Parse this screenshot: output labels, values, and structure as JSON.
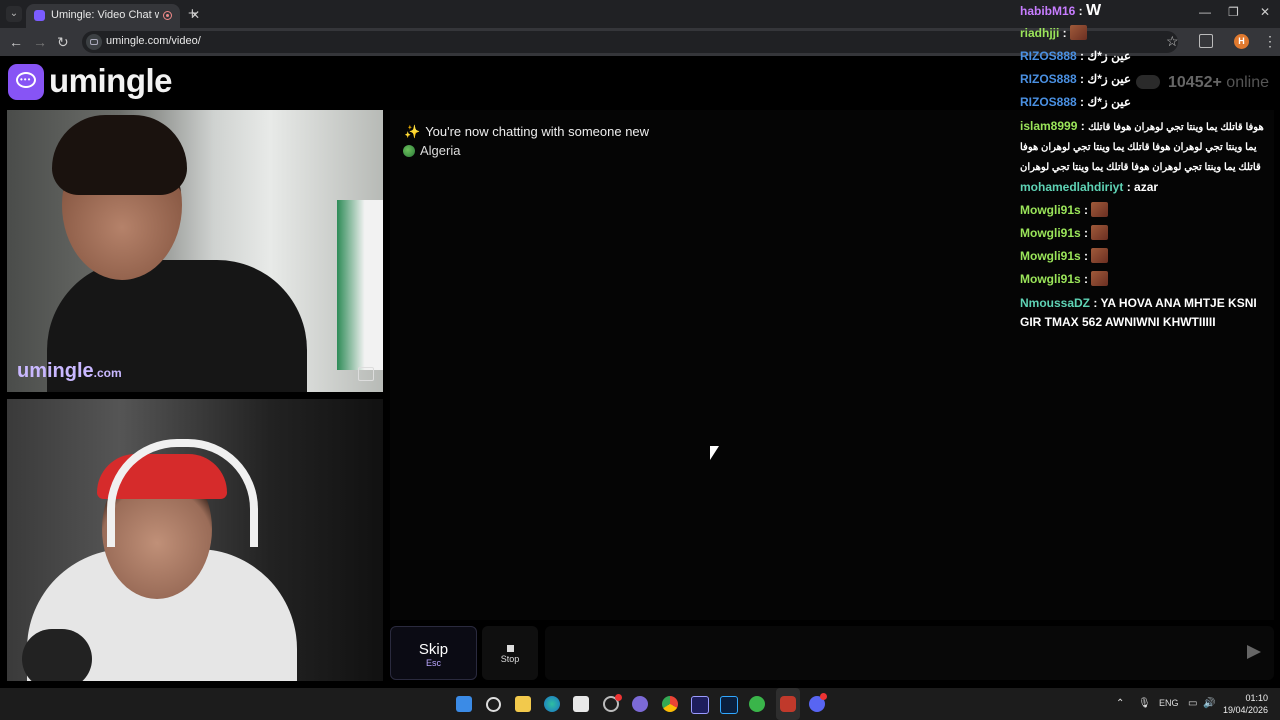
{
  "browser": {
    "tab_title": "Umingle: Video Chat with S",
    "url": "umingle.com/video/",
    "tab_close": "✕",
    "new_tab": "+",
    "back": "←",
    "forward": "→",
    "reload": "↻",
    "bookmark": "☆",
    "profile_initial": "H",
    "menu": "⋮",
    "minimize": "—",
    "restore": "❐",
    "close": "✕"
  },
  "site": {
    "logo_text": "umingle",
    "brand_color": "#8754f5"
  },
  "videos": {
    "watermark": "umingle",
    "watermark_suffix": ".com"
  },
  "chat": {
    "system_message": "You're now chatting with someone new",
    "system_icon": "sparkle-icon",
    "country": "Algeria",
    "input_placeholder": ""
  },
  "controls": {
    "skip_label": "Skip",
    "skip_key": "Esc",
    "stop_label": "Stop"
  },
  "status": {
    "online_count": "10452+",
    "online_label": "online"
  },
  "overlay_chat": [
    {
      "user": "habibM16",
      "color": "#c77dff",
      "text": "",
      "type": "w",
      "w": "W"
    },
    {
      "user": "riadhjji",
      "color": "#9be55a",
      "text": "",
      "type": "emote"
    },
    {
      "user": "RIZOS888",
      "color": "#4a90e2",
      "text": "عين ز*ك",
      "type": "text"
    },
    {
      "user": "RIZOS888",
      "color": "#4a90e2",
      "text": "عين ز*ك",
      "type": "text"
    },
    {
      "user": "RIZOS888",
      "color": "#4a90e2",
      "text": "عين ز*ك",
      "type": "text"
    },
    {
      "user": "islam8999",
      "color": "#9be55a",
      "text": "هوفا قاتلك يما وينتا تجي لوهران هوفا قاتلك يما وينتا تجي لوهران هوفا قاتلك يما وينتا تجي لوهران هوفا قاتلك يما وينتا تجي لوهران هوفا قاتلك يما وينتا تجي لوهران",
      "type": "text"
    },
    {
      "user": "mohamedlahdiriyt",
      "color": "#5fd3b5",
      "text": "azar",
      "type": "text"
    },
    {
      "user": "Mowgli91s",
      "color": "#9be55a",
      "text": "",
      "type": "emote"
    },
    {
      "user": "Mowgli91s",
      "color": "#9be55a",
      "text": "",
      "type": "emote"
    },
    {
      "user": "Mowgli91s",
      "color": "#9be55a",
      "text": "",
      "type": "emote"
    },
    {
      "user": "Mowgli91s",
      "color": "#9be55a",
      "text": "",
      "type": "emote"
    },
    {
      "user": "NmoussaDZ",
      "color": "#5fd3b5",
      "text": "YA HOVA ANA MHTJE KSNI GIR TMAX 562 AWNIWNI KHWTIIIII",
      "type": "text"
    }
  ],
  "taskbar": {
    "language": "ENG",
    "time": "01:10",
    "date": "19/04/2026",
    "apps": [
      "windows-start-icon",
      "search-icon",
      "file-explorer-icon",
      "edge-icon",
      "store-icon",
      "app-icon",
      "chat-app-icon",
      "chrome-icon",
      "premiere-icon",
      "photoshop-icon",
      "utorrent-icon",
      "media-player-icon",
      "discord-icon"
    ]
  }
}
